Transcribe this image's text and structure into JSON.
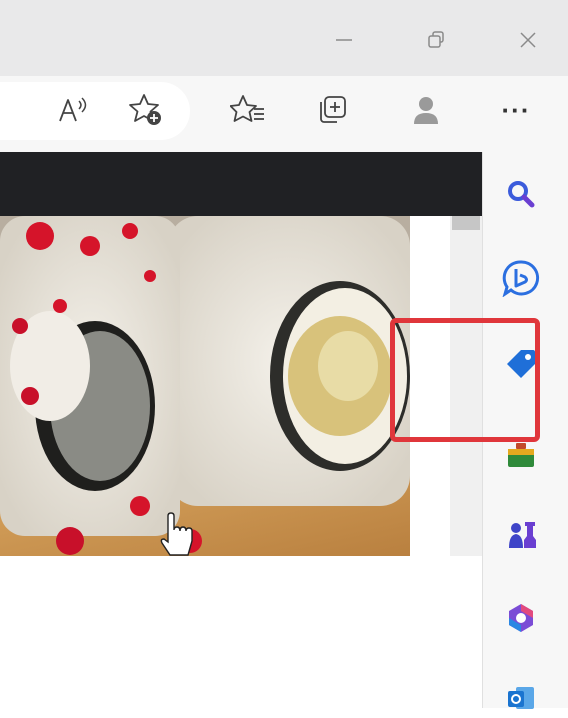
{
  "window": {
    "minimize_icon": "minimize-icon",
    "restore_icon": "restore-icon",
    "close_icon": "close-icon"
  },
  "toolbar": {
    "read_aloud_icon": "read-aloud-icon",
    "add_favorite_icon": "add-favorite-icon",
    "favorites_icon": "favorites-icon",
    "collections_icon": "collections-icon",
    "profile_icon": "profile-icon",
    "more_label": "···"
  },
  "sidebar": {
    "items": [
      {
        "name": "search",
        "icon": "search-icon",
        "color": "#3b5bdb"
      },
      {
        "name": "bing-chat",
        "icon": "bing-chat-icon",
        "color": "#2b6fe0"
      },
      {
        "name": "shopping",
        "icon": "shopping-tag-icon",
        "color": "#1f6fd8"
      },
      {
        "name": "tools",
        "icon": "tools-icon",
        "color": "#2f8a3a"
      },
      {
        "name": "games",
        "icon": "games-chess-icon",
        "color": "#3e44c8"
      },
      {
        "name": "office",
        "icon": "office-icon",
        "color": "#7b4cd6"
      },
      {
        "name": "outlook",
        "icon": "outlook-icon",
        "color": "#1a74d0"
      }
    ]
  },
  "colors": {
    "highlight": "#e0363b",
    "page_header": "#202124"
  }
}
